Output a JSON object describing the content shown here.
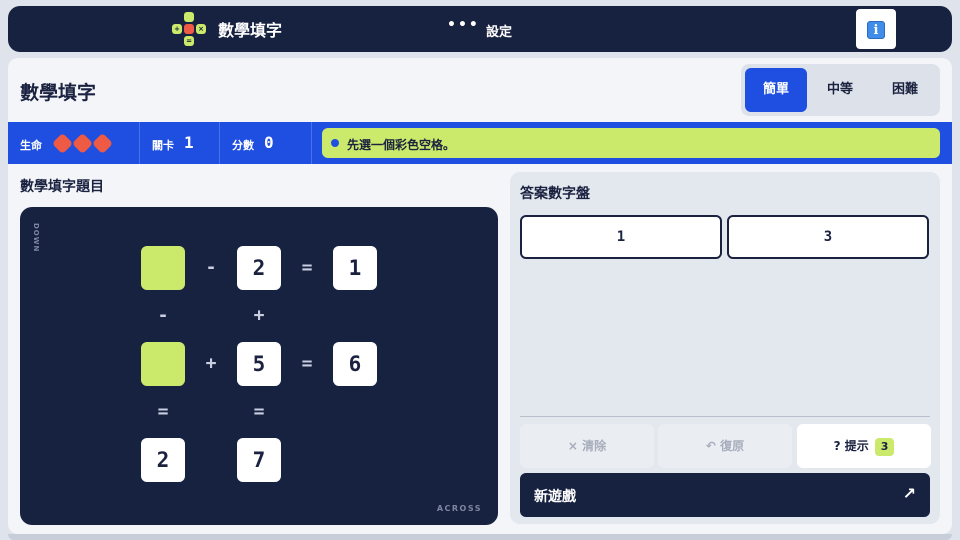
{
  "header": {
    "app_title": "數學填字",
    "menu_dots": "•••",
    "settings_label": "設定",
    "logo_symbols": [
      "+",
      "×",
      "="
    ],
    "info_icon": "i"
  },
  "page": {
    "title": "數學填字",
    "difficulty": {
      "options": [
        "簡單",
        "中等",
        "困難"
      ],
      "selected": "簡單"
    }
  },
  "status_bar": {
    "lives_label": "生命",
    "lives_count": 3,
    "level_label": "關卡",
    "level_value": "1",
    "score_label": "分數",
    "score_value": "0",
    "message": "先選一個彩色空格。"
  },
  "puzzle": {
    "section_title": "數學填字題目",
    "down_label": "DOWN",
    "across_label": "ACROSS",
    "cells": {
      "r1c1": "",
      "r1c2": "-",
      "r1c3": "2",
      "r1c4": "=",
      "r1c5": "1",
      "r2c1": "-",
      "r2c3": "+",
      "r3c1": "",
      "r3c2": "+",
      "r3c3": "5",
      "r3c4": "=",
      "r3c5": "6",
      "r4c1": "=",
      "r4c3": "=",
      "r5c1": "2",
      "r5c3": "7"
    }
  },
  "answer_pad": {
    "title": "答案數字盤",
    "numbers": [
      "1",
      "3"
    ],
    "clear_label": "× 清除",
    "undo_label": "↶ 復原",
    "hint_label": "? 提示",
    "hint_count": "3",
    "new_game_label": "新遊戲",
    "new_game_arrow": "↗"
  },
  "colors": {
    "navy": "#172140",
    "blue": "#1f4fe0",
    "lime": "#cbe96a",
    "heart": "#ee5a44"
  }
}
